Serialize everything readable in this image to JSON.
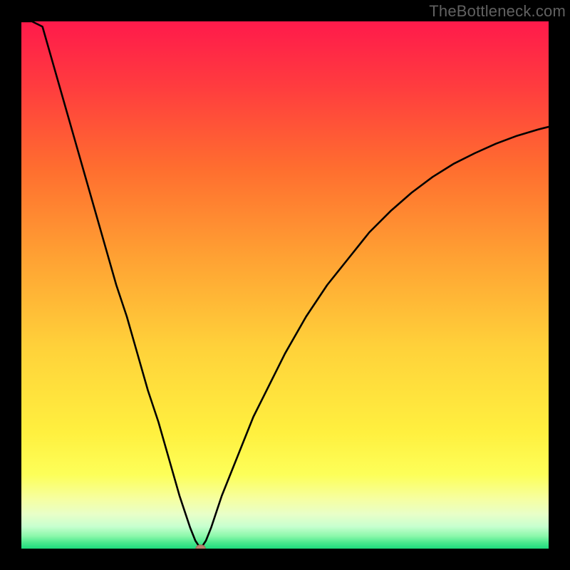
{
  "watermark": "TheBottleneck.com",
  "colors": {
    "black": "#000000",
    "curve": "#000000",
    "marker_fill": "#b9806d",
    "marker_stroke": "#a36b58",
    "gradient_stops": [
      {
        "offset": 0.0,
        "color": "#ff1a4b"
      },
      {
        "offset": 0.12,
        "color": "#ff3b3f"
      },
      {
        "offset": 0.28,
        "color": "#ff6e2f"
      },
      {
        "offset": 0.45,
        "color": "#ffa233"
      },
      {
        "offset": 0.62,
        "color": "#ffd23a"
      },
      {
        "offset": 0.78,
        "color": "#fff03f"
      },
      {
        "offset": 0.86,
        "color": "#fdff59"
      },
      {
        "offset": 0.905,
        "color": "#f6ffa0"
      },
      {
        "offset": 0.935,
        "color": "#e8ffc8"
      },
      {
        "offset": 0.958,
        "color": "#c7ffcf"
      },
      {
        "offset": 0.976,
        "color": "#8cf8ab"
      },
      {
        "offset": 0.988,
        "color": "#4de98f"
      },
      {
        "offset": 1.0,
        "color": "#1edb7c"
      }
    ]
  },
  "chart_data": {
    "type": "line",
    "title": "",
    "xlabel": "",
    "ylabel": "",
    "xlim": [
      0,
      100
    ],
    "ylim": [
      0,
      100
    ],
    "grid": false,
    "legend": false,
    "note": "V-shaped bottleneck curve over red→green vertical heat gradient. x is an arbitrary component-balance axis (0–100); y is bottleneck % (0 at bottom, 100 at top). Minimum ≈ (34, 0). Values are read off pixel positions.",
    "series": [
      {
        "name": "bottleneck-curve",
        "x": [
          0,
          2,
          4,
          6,
          8,
          10,
          12,
          14,
          16,
          18,
          20,
          22,
          24,
          26,
          28,
          30,
          31,
          32,
          33,
          34,
          35,
          36,
          37,
          38,
          40,
          42,
          44,
          46,
          48,
          50,
          54,
          58,
          62,
          66,
          70,
          74,
          78,
          82,
          86,
          90,
          94,
          98,
          100
        ],
        "y": [
          114,
          106,
          99,
          92,
          85,
          78,
          71,
          64,
          57,
          50,
          44,
          37,
          30,
          24,
          17,
          10,
          7,
          4,
          1.5,
          0,
          1.5,
          4,
          7,
          10,
          15,
          20,
          25,
          29,
          33,
          37,
          44,
          50,
          55,
          60,
          64,
          67.5,
          70.5,
          73,
          75,
          76.8,
          78.3,
          79.5,
          80
        ]
      }
    ],
    "marker": {
      "x": 34,
      "y": 0,
      "rx": 0.9,
      "ry": 0.7
    }
  }
}
